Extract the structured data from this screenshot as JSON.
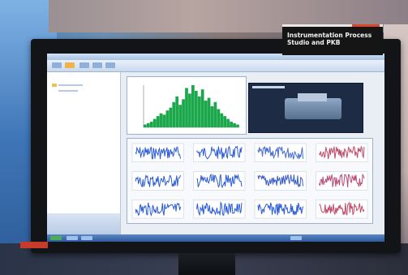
{
  "sign": {
    "line1": "Instrumentation Process",
    "line2": "Studio and PKB"
  },
  "tag": {
    "label": ""
  },
  "histogram": {
    "color": "#1aa84a",
    "values": [
      2,
      3,
      4,
      6,
      8,
      10,
      9,
      12,
      14,
      18,
      22,
      16,
      20,
      28,
      24,
      30,
      26,
      22,
      27,
      19,
      21,
      15,
      18,
      13,
      10,
      8,
      6,
      4,
      3,
      2
    ]
  },
  "waveforms": {
    "colors": [
      "#2a5bd7",
      "#2a5bd7",
      "#4a6fd0",
      "#c04a6a",
      "#2a5bd7",
      "#2a5bd7",
      "#3a5cc8",
      "#b84a78",
      "#2a5bd7",
      "#2a5bd7",
      "#2a5bd7",
      "#c04a6a"
    ]
  },
  "colors": {
    "screen_bg": "#e9eef5",
    "accent": "#2f5b9e"
  }
}
